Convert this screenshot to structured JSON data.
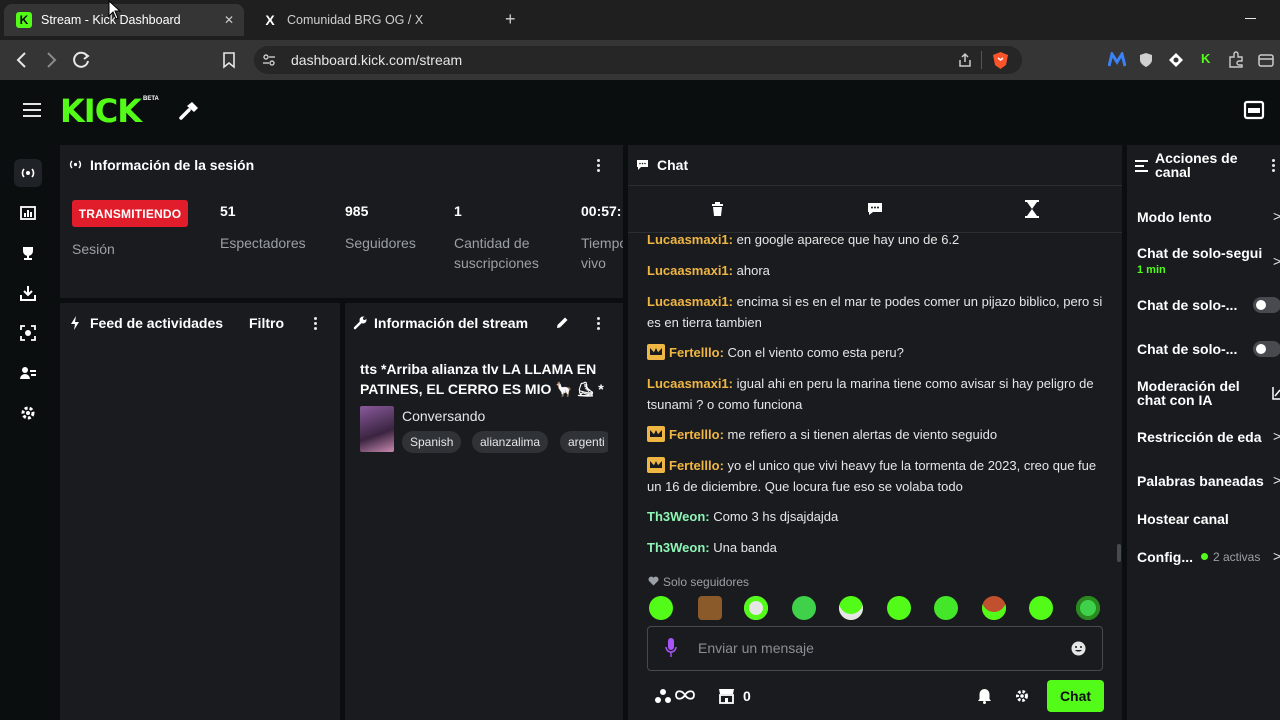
{
  "browser": {
    "tabs": [
      {
        "title": "Stream - Kick Dashboard",
        "favicon": "K"
      },
      {
        "title": "Comunidad BRG OG / X",
        "favicon": "X"
      }
    ],
    "url": "dashboard.kick.com/stream"
  },
  "header": {
    "logo_text": "KICK",
    "beta_label": "BETA"
  },
  "session": {
    "title": "Información de la sesión",
    "status_badge": "TRANSMITIENDO",
    "session_label": "Sesión",
    "stats": [
      {
        "value": "51",
        "label": "Espectadores"
      },
      {
        "value": "985",
        "label": "Seguidores"
      },
      {
        "value": "1",
        "label": "Cantidad de suscripciones"
      },
      {
        "value": "00:57:",
        "label": "Tiempo en vivo"
      }
    ]
  },
  "feed": {
    "title": "Feed de actividades",
    "filter_label": "Filtro"
  },
  "stream_info": {
    "title": "Información del stream",
    "stream_title": "tts *Arriba alianza tlv LA LLAMA EN PATINES, EL CERRO ES MIO 🦙 ⛸ *",
    "category": "Conversando",
    "tags": [
      "Spanish",
      "alianzalima",
      "argenti"
    ]
  },
  "chat": {
    "title": "Chat",
    "messages": [
      {
        "user": "Lucaasmaxi1",
        "color": "orange",
        "crown": false,
        "text": "en google aparece que hay uno de 6.2"
      },
      {
        "user": "Lucaasmaxi1",
        "color": "orange",
        "crown": false,
        "text": "ahora"
      },
      {
        "user": "Lucaasmaxi1",
        "color": "orange",
        "crown": false,
        "text": "encima si es en el mar te podes comer un pijazo biblico, pero si es en tierra tambien"
      },
      {
        "user": "Fertelllo",
        "color": "orange",
        "crown": true,
        "text": "Con el viento como esta peru?"
      },
      {
        "user": "Lucaasmaxi1",
        "color": "orange",
        "crown": false,
        "text": "igual ahi en peru la marina tiene como avisar si hay peligro de tsunami ? o como funciona"
      },
      {
        "user": "Fertelllo",
        "color": "orange",
        "crown": true,
        "text": "me refiero a si tienen alertas de viento seguido"
      },
      {
        "user": "Fertelllo",
        "color": "orange",
        "crown": true,
        "text": "yo el unico que vivi heavy fue la tormenta de 2023, creo que fue un 16 de diciembre. Que locura fue eso se volaba todo"
      },
      {
        "user": "Th3Weon",
        "color": "green",
        "crown": false,
        "text": "Como 3 hs djsajdajda"
      },
      {
        "user": "Th3Weon",
        "color": "green",
        "crown": false,
        "text": "Una banda"
      }
    ],
    "followers_only_label": "Solo seguidores",
    "input_placeholder": "Enviar un mensaje",
    "points_count": "0",
    "send_label": "Chat"
  },
  "actions": {
    "title": "Acciones de canal",
    "items": [
      {
        "label": "Modo lento",
        "sub": "",
        "control": "chevron"
      },
      {
        "label": "Chat de solo-segui",
        "sub": "1 min",
        "control": "chevron"
      },
      {
        "label": "Chat de solo-...",
        "sub": "",
        "control": "toggle"
      },
      {
        "label": "Chat de solo-...",
        "sub": "",
        "control": "toggle"
      },
      {
        "label": "Moderación del chat con IA",
        "sub": "",
        "control": "external"
      },
      {
        "label": "Restricción de eda",
        "sub": "",
        "control": "chevron"
      },
      {
        "label": "Palabras baneadas",
        "sub": "",
        "control": "chevron"
      },
      {
        "label": "Hostear canal",
        "sub": "",
        "control": "none"
      },
      {
        "label": "Config...",
        "sub": "2 activas",
        "control": "chevron"
      }
    ]
  },
  "colors": {
    "brand": "#53fc18",
    "live": "#e11d2b",
    "username_orange": "#f0b643",
    "username_green": "#8ef5b5"
  }
}
